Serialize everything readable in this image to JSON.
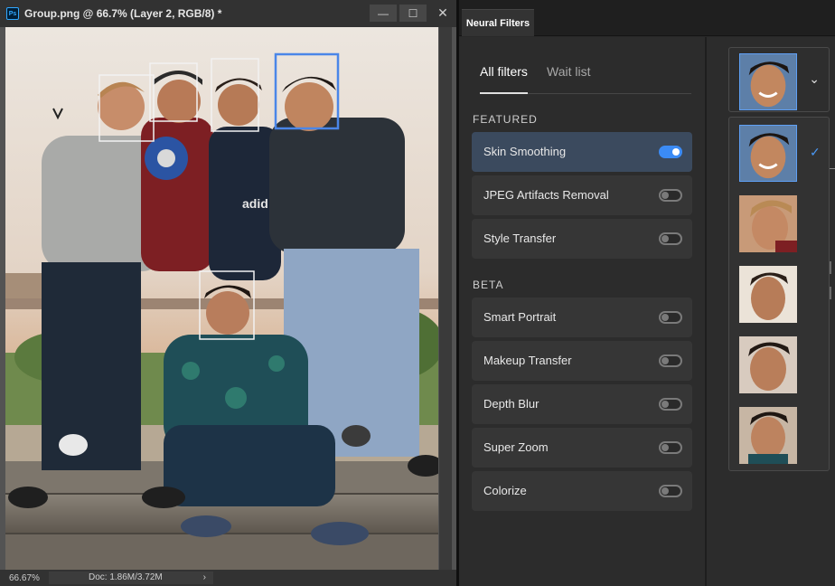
{
  "document": {
    "title": "Group.png @ 66.7% (Layer 2, RGB/8) *",
    "app_icon": "ps-icon",
    "app_icon_text": "Ps",
    "zoom": "66.67%",
    "doc_info": "Doc: 1.86M/3.72M",
    "status_arrow": "›",
    "window_buttons": {
      "minimize": "—",
      "maximize": "☐",
      "close": "✕"
    }
  },
  "neural_filters": {
    "panel_tab": "Neural Filters",
    "tabs": {
      "all": "All filters",
      "wait": "Wait list"
    },
    "sections": [
      {
        "heading": "FEATURED",
        "filters": [
          {
            "label": "Skin Smoothing",
            "on": true,
            "selected": true
          },
          {
            "label": "JPEG Artifacts Removal",
            "on": false,
            "selected": false
          },
          {
            "label": "Style Transfer",
            "on": false,
            "selected": false
          }
        ]
      },
      {
        "heading": "BETA",
        "filters": [
          {
            "label": "Smart Portrait",
            "on": false,
            "selected": false
          },
          {
            "label": "Makeup Transfer",
            "on": false,
            "selected": false
          },
          {
            "label": "Depth Blur",
            "on": false,
            "selected": false
          },
          {
            "label": "Super Zoom",
            "on": false,
            "selected": false
          },
          {
            "label": "Colorize",
            "on": false,
            "selected": false
          }
        ]
      }
    ],
    "face_selector": {
      "chevron": "⌄",
      "check_mark": "✓",
      "selected_index": 0,
      "faces_count": 5
    }
  },
  "colors": {
    "accent": "#3b8bf5",
    "selection_box": "#4a86e8",
    "panel_bg": "#2c2c2c",
    "row_bg": "#363636",
    "row_selected": "#3b4a5e"
  }
}
